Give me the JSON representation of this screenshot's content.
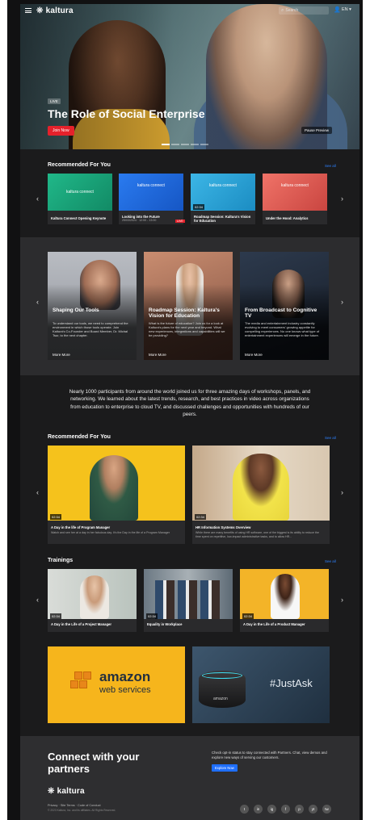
{
  "header": {
    "logo_text": "kaltura",
    "search_placeholder": "Search",
    "language": "EN"
  },
  "hero": {
    "badge": "LIVE",
    "title": "The Role of Social Enterprise",
    "join_button": "Join Now",
    "pause_button": "Pause Preview"
  },
  "recommended1": {
    "title": "Recommended For You",
    "see_all": "See all",
    "cards": [
      {
        "logo": "kaltura connect",
        "title": "Kaltura Connect Opening Keynote",
        "sub": "",
        "color": "#1aa87c"
      },
      {
        "logo": "kaltura connect",
        "title": "Looking into the Future",
        "sub": "25/03/2024 · 12:00 - 13:00",
        "live": "LIVE",
        "color": "#1b66d8"
      },
      {
        "logo": "kaltura connect",
        "title": "Roadmap Session: Kaltura's Vision for Education",
        "sub": "",
        "duration": "02:34",
        "color": "#27a3d6"
      },
      {
        "logo": "kaltura connect",
        "title": "Under the Hood: Analytics",
        "sub": "",
        "color": "#e3564d"
      }
    ],
    "card_duration": "02:34"
  },
  "features": [
    {
      "title": "Shaping Our Tools",
      "desc": "To understand our tools, we need to comprehend the environment in which those tools operate. Join Kaltura's Co-Founder and Board Member, Dr. Michal Tsur, to the next chapter.",
      "more": "More More"
    },
    {
      "title": "Roadmap Session: Kaltura's Vision for Education",
      "desc": "What is the future of education? Join us for a look at Kaltura's plans for the next year and beyond. What new experiences, integrations and capabilities will we be providing?",
      "more": "More More"
    },
    {
      "title": "From Broadcast to Cognitive TV",
      "desc": "The media and entertainment industry constantly evolving to meet consumers' growing appetite for compelling experiences. No one knows what type of entertainment experiences will emerge in the future.",
      "more": "More More"
    }
  ],
  "intro_text": "Nearly 1000 participants from around the world joined us for three amazing days of workshops, panels, and networking. We learned about the latest trends, research, and best practices in video across organizations from education to enterprise to cloud TV, and discussed challenges and opportunities with hundreds of our peers.",
  "recommended2": {
    "title": "Recommended For You",
    "see_all": "See all",
    "cards": [
      {
        "duration": "02:34",
        "title": "A Day in the life of Program Manager",
        "sub": "Watch and see her at a day in her fabulous day. It's the Day in the life of a Program Manager"
      },
      {
        "duration": "02:34",
        "title": "HR Information Systems Overview",
        "sub": "While there are many benefits of using HR software, one of the biggest is its ability to reduce the time spent on repetitive, low-impact administrative tasks, and to allow HR..."
      }
    ]
  },
  "trainings": {
    "title": "Trainings",
    "see_all": "See all",
    "cards": [
      {
        "duration": "02:34",
        "title": "A Day in the Life of a Project Manager"
      },
      {
        "duration": "02:34",
        "title": "Equality in Workplace"
      },
      {
        "duration": "02:34",
        "title": "A Day in the Life of a Product Manager"
      }
    ]
  },
  "sponsors": {
    "amazon_main": "amazon",
    "amazon_sub": "web services",
    "echo_brand": "amazon",
    "echo_tag": "#JustAsk"
  },
  "footer": {
    "headline": "Connect with your partners",
    "text": "Check opt-in status to stay connected with Partners. Chat, view demos and explore new ways of serving our customers.",
    "button": "Explore Now",
    "logo_text": "kaltura",
    "links": "Privacy  ·  Site Terms  ·  Code of Conduct",
    "copyright": "© 2023 Kaltura, Inc. and its affiliates. All Rights Reserved.",
    "social": [
      "t",
      "in",
      "ig",
      "f",
      "p",
      "yt",
      "tw"
    ]
  }
}
